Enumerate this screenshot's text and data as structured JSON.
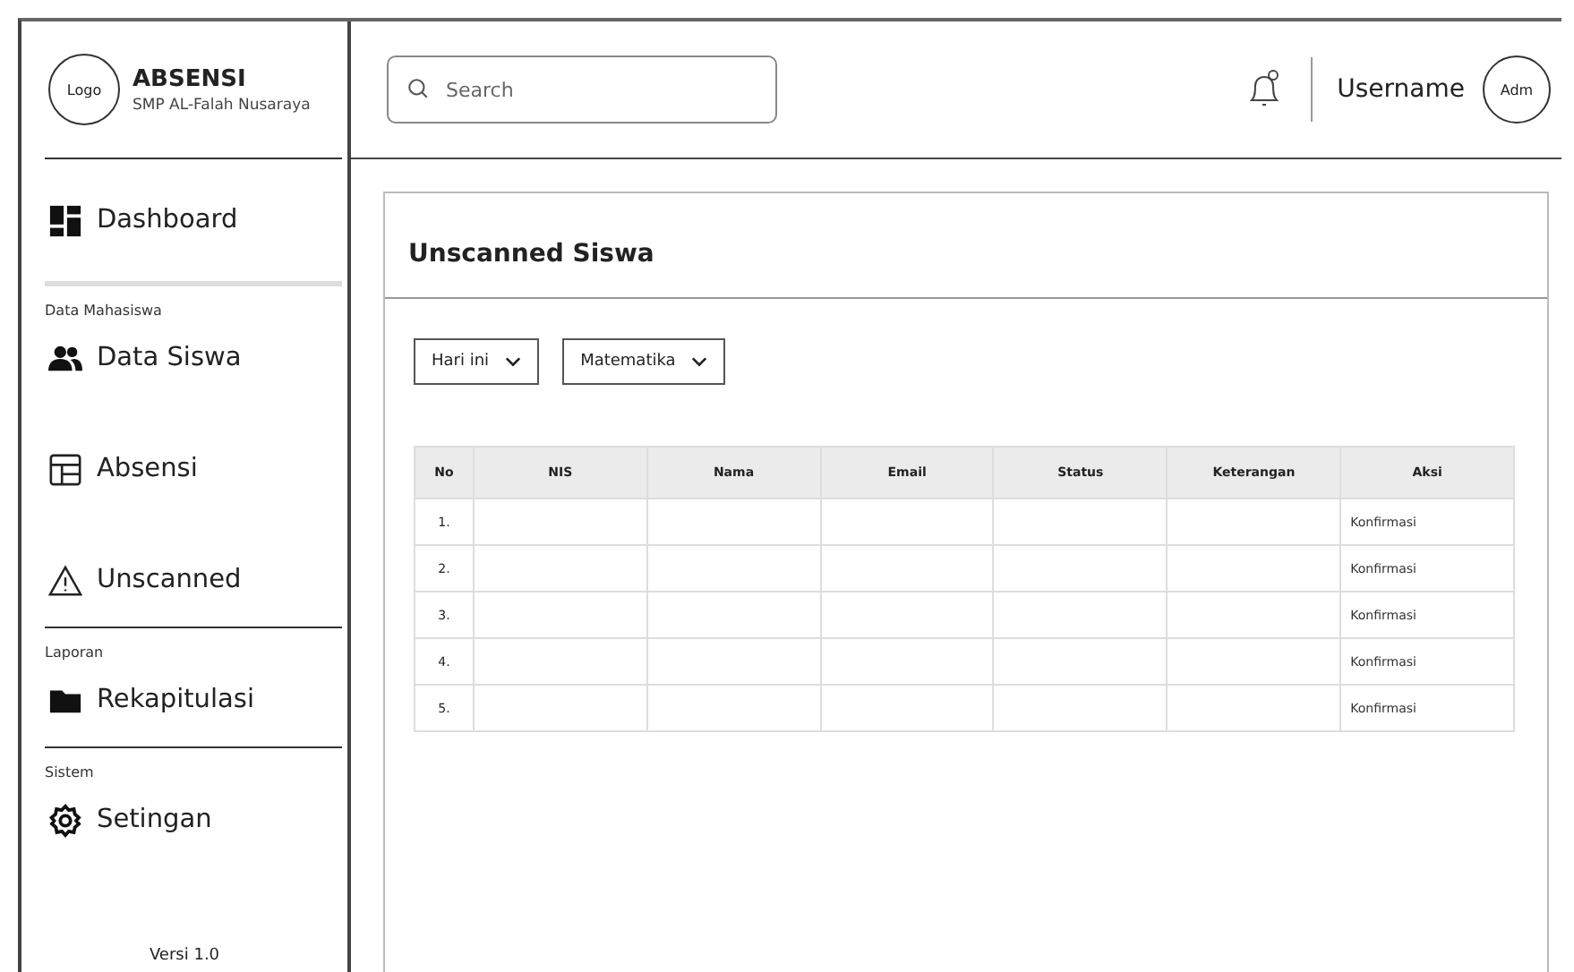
{
  "brand": {
    "logo": "Logo",
    "title": "ABSENSI",
    "subtitle": "SMP AL-Falah Nusaraya"
  },
  "sidebar": {
    "sections": [
      {
        "items": [
          {
            "label": "Dashboard",
            "kind": "dashboard"
          }
        ]
      },
      {
        "heading": "Data Mahasiswa",
        "items": [
          {
            "label": "Data Siswa",
            "kind": "people"
          },
          {
            "label": "Absensi",
            "kind": "table"
          },
          {
            "label": "Unscanned",
            "kind": "warning"
          }
        ]
      },
      {
        "heading": "Laporan",
        "items": [
          {
            "label": "Rekapitulasi",
            "kind": "folder"
          }
        ]
      },
      {
        "heading": "Sistem",
        "items": [
          {
            "label": "Setingan",
            "kind": "gear"
          }
        ]
      }
    ],
    "version": "Versi 1.0"
  },
  "header": {
    "search": {
      "placeholder": "Search"
    },
    "username": "Username",
    "avatar": "Adm"
  },
  "card": {
    "title": "Unscanned Siswa",
    "filters": [
      "Hari ini",
      "Matematika"
    ],
    "table": {
      "columns": [
        "No",
        "NIS",
        "Nama",
        "Email",
        "Status",
        "Keterangan",
        "Aksi"
      ],
      "rows": [
        {
          "no": "1.",
          "action": "Konfirmasi"
        },
        {
          "no": "2.",
          "action": "Konfirmasi"
        },
        {
          "no": "3.",
          "action": "Konfirmasi"
        },
        {
          "no": "4.",
          "action": "Konfirmasi"
        },
        {
          "no": "5.",
          "action": "Konfirmasi"
        }
      ]
    }
  }
}
